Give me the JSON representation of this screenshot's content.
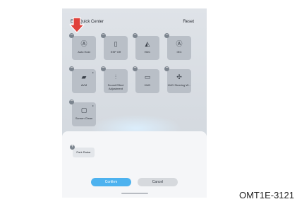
{
  "header": {
    "title": "Edit Quick Center",
    "reset": "Reset"
  },
  "tiles": [
    {
      "label": "Auto Hold",
      "icon": "auto-hold-icon",
      "glyph": "Ⓐ"
    },
    {
      "label": "ESP Off",
      "icon": "esp-off-icon",
      "glyph": "▯"
    },
    {
      "label": "HDC",
      "icon": "hdc-icon",
      "glyph": "◭"
    },
    {
      "label": "ISG",
      "icon": "isg-icon",
      "glyph": "Ⓐ"
    },
    {
      "label": "AVM",
      "icon": "avm-icon",
      "glyph": "▰"
    },
    {
      "label": "Sound Effect Adjustment",
      "icon": "sound-effect-icon",
      "glyph": "⫶"
    },
    {
      "label": "HUD",
      "icon": "hud-icon",
      "glyph": "▭"
    },
    {
      "label": "HUD Steering W...",
      "icon": "hud-steering-icon",
      "glyph": "✣"
    },
    {
      "label": "Screen Clean",
      "icon": "screen-clean-icon",
      "glyph": "▢"
    }
  ],
  "tray": {
    "chip_label": "Park Radar"
  },
  "buttons": {
    "confirm": "Confirm",
    "cancel": "Cancel"
  },
  "caption": "OMT1E-3121",
  "colors": {
    "arrow": "#e0413a",
    "confirm": "#4db2ef"
  }
}
